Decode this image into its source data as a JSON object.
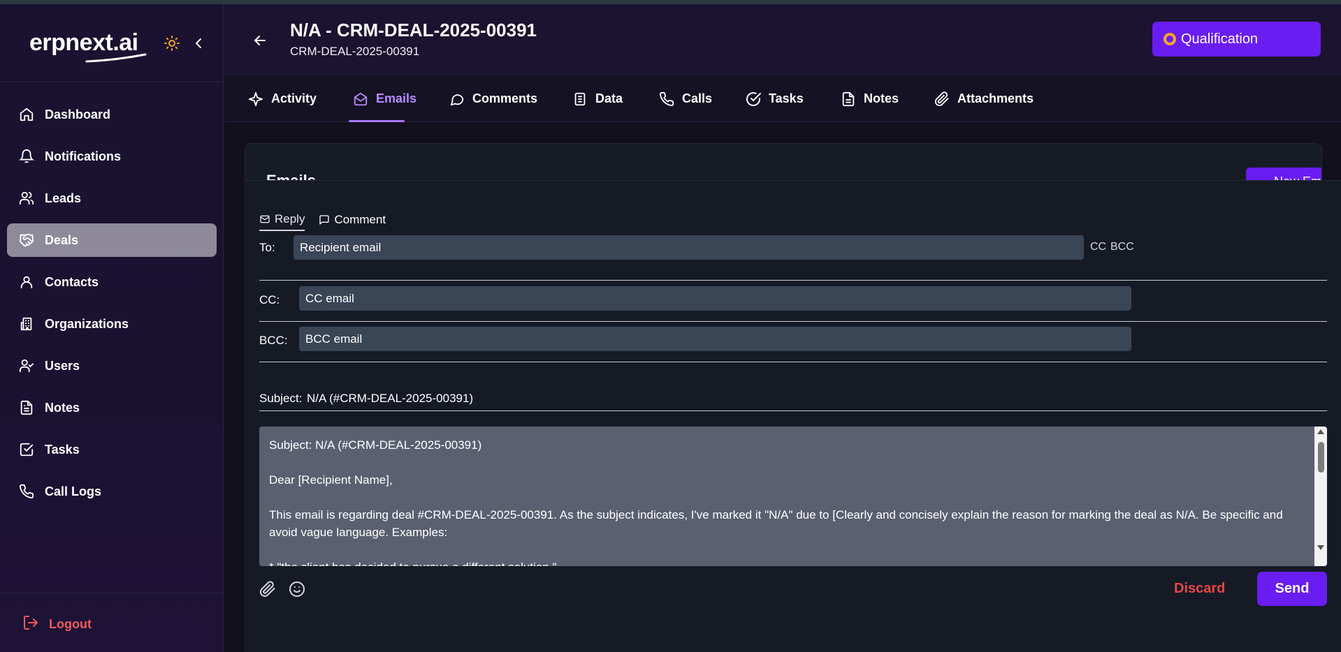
{
  "brand": {
    "name": "erpnext.ai"
  },
  "sidebar": {
    "items": [
      {
        "label": "Dashboard",
        "icon": "home-icon",
        "active": false
      },
      {
        "label": "Notifications",
        "icon": "bell-icon",
        "active": false
      },
      {
        "label": "Leads",
        "icon": "users-icon",
        "active": false
      },
      {
        "label": "Deals",
        "icon": "handshake-icon",
        "active": true
      },
      {
        "label": "Contacts",
        "icon": "user-icon",
        "active": false
      },
      {
        "label": "Organizations",
        "icon": "building-icon",
        "active": false
      },
      {
        "label": "Users",
        "icon": "user-check-icon",
        "active": false
      },
      {
        "label": "Notes",
        "icon": "file-text-icon",
        "active": false
      },
      {
        "label": "Tasks",
        "icon": "check-square-icon",
        "active": false
      },
      {
        "label": "Call Logs",
        "icon": "phone-icon",
        "active": false
      }
    ],
    "logout_label": "Logout"
  },
  "header": {
    "title": "N/A - CRM-DEAL-2025-00391",
    "subtitle": "CRM-DEAL-2025-00391",
    "stage_label": "Qualification"
  },
  "tabs": [
    {
      "label": "Activity",
      "icon": "sparkle-icon",
      "active": false
    },
    {
      "label": "Emails",
      "icon": "mail-open-icon",
      "active": true
    },
    {
      "label": "Comments",
      "icon": "message-icon",
      "active": false
    },
    {
      "label": "Data",
      "icon": "clipboard-icon",
      "active": false
    },
    {
      "label": "Calls",
      "icon": "phone-icon",
      "active": false
    },
    {
      "label": "Tasks",
      "icon": "check-circle-icon",
      "active": false
    },
    {
      "label": "Notes",
      "icon": "file-text-icon",
      "active": false
    },
    {
      "label": "Attachments",
      "icon": "paperclip-icon",
      "active": false
    }
  ],
  "card": {
    "title": "Emails",
    "new_email_label": "New Email"
  },
  "composer": {
    "tabs": [
      {
        "label": "Reply",
        "icon": "mail-icon",
        "active": true
      },
      {
        "label": "Comment",
        "icon": "message-icon",
        "active": false
      }
    ],
    "to_label": "To:",
    "to_placeholder": "Recipient email",
    "cc_link": "CC",
    "bcc_link": "BCC",
    "cc_label": "CC:",
    "cc_placeholder": "CC email",
    "bcc_label": "BCC:",
    "bcc_placeholder": "BCC email",
    "subject_label": "Subject:",
    "subject_value": "N/A (#CRM-DEAL-2025-00391)",
    "body": {
      "line1": "Subject: N/A (#CRM-DEAL-2025-00391)",
      "line2": "Dear [Recipient Name],",
      "line3": "This email is regarding deal #CRM-DEAL-2025-00391. As the subject indicates, I've marked it \"N/A\" due to [Clearly and concisely explain the reason for marking the deal as N/A. Be specific and avoid vague language. Examples:",
      "line4": "*  \"the client has decided to pursue a different solution.\""
    },
    "discard_label": "Discard",
    "send_label": "Send"
  },
  "colors": {
    "accent": "#6a1df0",
    "danger": "#e84545",
    "stage_dot": "#f5a623"
  }
}
